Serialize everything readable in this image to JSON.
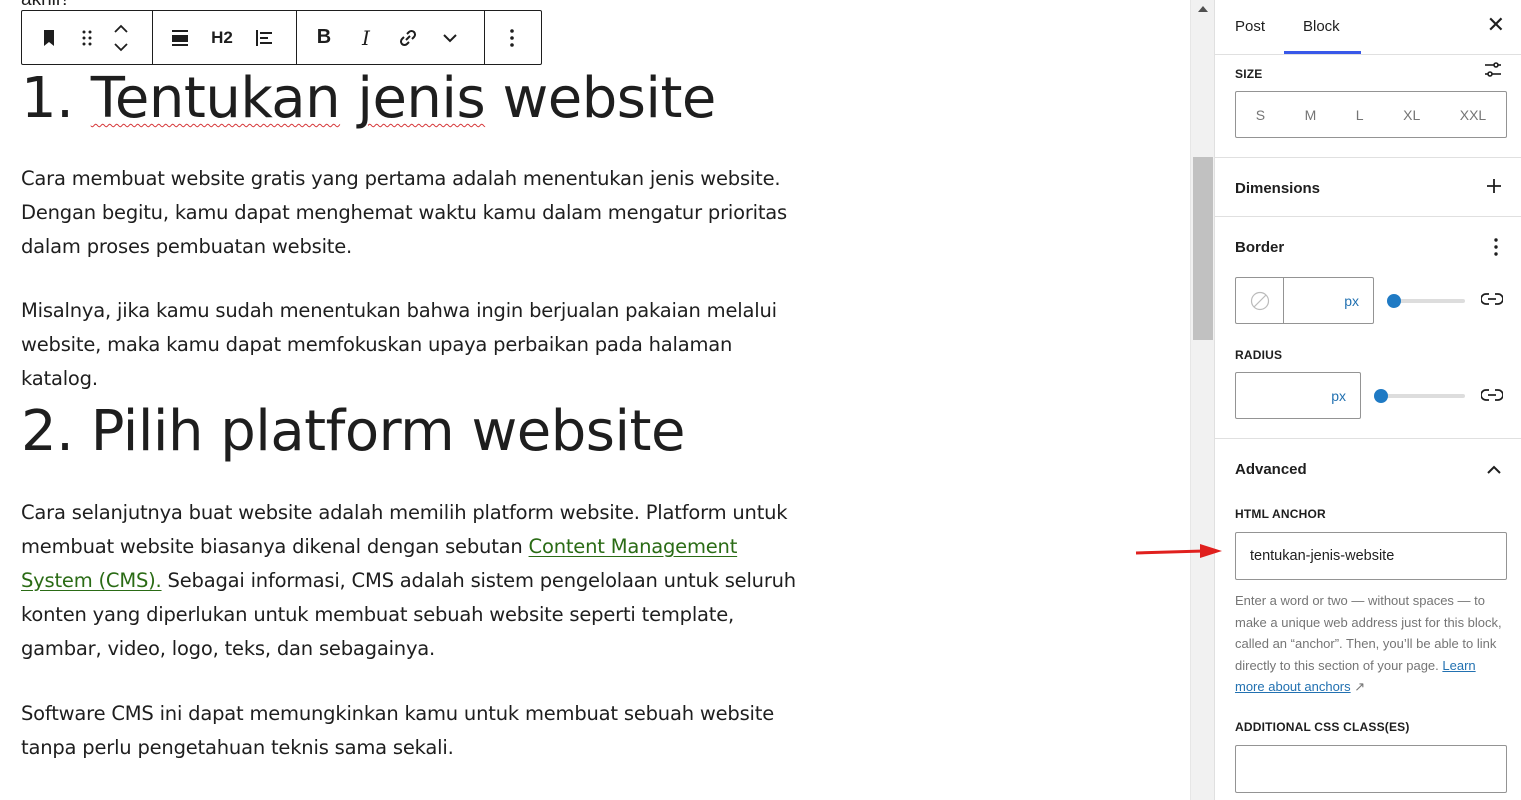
{
  "editor": {
    "top_fragment": "akhir!",
    "heading1": {
      "number": "1. ",
      "word_tentukan": "Tentukan",
      "word_jenis": "jenis",
      "rest": " website"
    },
    "para1": "Cara membuat website gratis yang pertama adalah menentukan jenis website. Dengan begitu, kamu dapat menghemat waktu kamu dalam mengatur prioritas dalam proses pembuatan website.",
    "para2": "Misalnya, jika kamu sudah menentukan bahwa ingin berjualan pakaian melalui website, maka kamu dapat memfokuskan upaya perbaikan pada halaman katalog.",
    "heading2": "2. Pilih platform website",
    "para3_before": "Cara selanjutnya buat website adalah memilih platform website. Platform untuk membuat website biasanya dikenal dengan sebutan ",
    "para3_link": "Content Management System (CMS).",
    "para3_after": " Sebagai informasi, CMS adalah sistem pengelolaan untuk seluruh konten yang diperlukan untuk membuat sebuah website seperti template, gambar, video, logo, teks, dan sebagainya.",
    "para4": "Software CMS ini dapat memungkinkan kamu untuk membuat sebuah website tanpa perlu pengetahuan teknis sama sekali."
  },
  "toolbar": {
    "heading_level": "H2",
    "bold": "B",
    "italic": "I",
    "icons": [
      "bookmark-icon",
      "drag-handle-icon",
      "move-up-down-icon",
      "align-icon",
      "text-align-icon",
      "link-icon",
      "chevron-down-icon",
      "more-options-icon"
    ]
  },
  "sidebar": {
    "tabs": [
      "Post",
      "Block"
    ],
    "active_tab": "Block",
    "size": {
      "label": "SIZE",
      "options": [
        "S",
        "M",
        "L",
        "XL",
        "XXL"
      ]
    },
    "dimensions": {
      "label": "Dimensions"
    },
    "border": {
      "label": "Border",
      "unit": "px",
      "radius_label": "RADIUS",
      "radius_unit": "px"
    },
    "advanced": {
      "label": "Advanced",
      "anchor_label": "HTML ANCHOR",
      "anchor_value": "tentukan-jenis-website",
      "help_text": "Enter a word or two — without spaces — to make a unique web address just for this block, called an “anchor”. Then, you’ll be able to link directly to this section of your page. ",
      "help_link": "Learn more about anchors",
      "help_link_icon": "↗",
      "css_label": "ADDITIONAL CSS CLASS(ES)",
      "css_value": ""
    }
  },
  "colors": {
    "accent": "#3858e9",
    "link": "#2a6b15",
    "slider": "#1f7ac4",
    "annotation": "#e0201e"
  }
}
